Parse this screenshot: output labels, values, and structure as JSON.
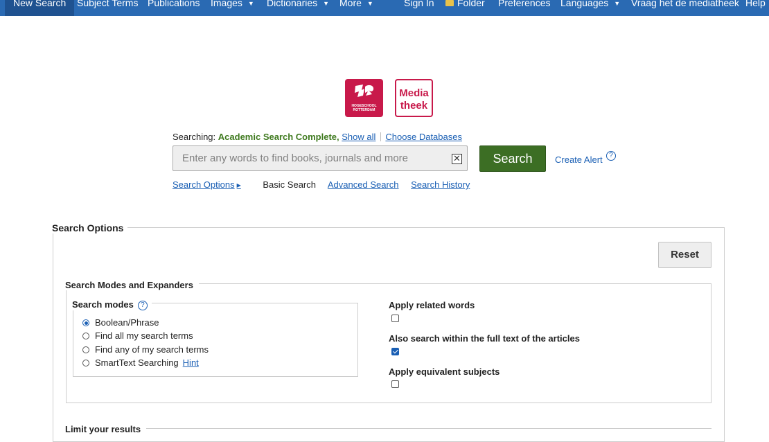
{
  "nav": {
    "new_search": "New Search",
    "subject_terms": "Subject Terms",
    "publications": "Publications",
    "images": "Images",
    "dictionaries": "Dictionaries",
    "more": "More",
    "sign_in": "Sign In",
    "folder": "Folder",
    "preferences": "Preferences",
    "languages": "Languages",
    "ask_library": "Vraag het de mediatheek",
    "help": "Help"
  },
  "logos": {
    "hr_line1": "HOGESCHOOL",
    "hr_line2": "ROTTERDAM",
    "mt_line1": "Media",
    "mt_line2": "theek"
  },
  "search": {
    "searching_label": "Searching:",
    "database": "Academic Search Complete,",
    "show_all": "Show all",
    "choose_databases": "Choose Databases",
    "placeholder": "Enter any words to find books, journals and more",
    "button": "Search",
    "create_alert": "Create Alert",
    "help_glyph": "?"
  },
  "sublinks": {
    "search_options": "Search Options",
    "basic_search": "Basic Search",
    "advanced_search": "Advanced Search",
    "search_history": "Search History"
  },
  "options": {
    "title": "Search Options",
    "reset": "Reset",
    "modes_expanders_title": "Search Modes and Expanders",
    "search_modes_title": "Search modes",
    "help_glyph": "?",
    "modes": [
      {
        "label": "Boolean/Phrase",
        "selected": true
      },
      {
        "label": "Find all my search terms",
        "selected": false
      },
      {
        "label": "Find any of my search terms",
        "selected": false
      },
      {
        "label": "SmartText Searching",
        "selected": false
      }
    ],
    "hint": "Hint",
    "expanders": [
      {
        "label": "Apply related words",
        "checked": false
      },
      {
        "label": "Also search within the full text of the articles",
        "checked": true
      },
      {
        "label": "Apply equivalent subjects",
        "checked": false
      }
    ],
    "limit_title": "Limit your results"
  }
}
